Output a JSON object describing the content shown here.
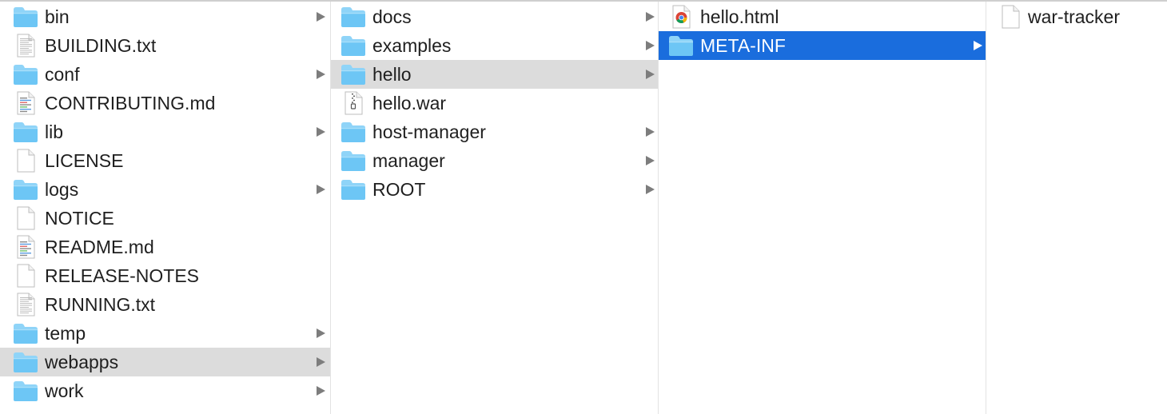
{
  "columns": [
    {
      "items": [
        {
          "label": "bin",
          "icon": "folder-icon",
          "arrow": true
        },
        {
          "label": "BUILDING.txt",
          "icon": "text-file-icon",
          "arrow": false
        },
        {
          "label": "conf",
          "icon": "folder-icon",
          "arrow": true
        },
        {
          "label": "CONTRIBUTING.md",
          "icon": "markdown-file-icon",
          "arrow": false
        },
        {
          "label": "lib",
          "icon": "folder-icon",
          "arrow": true
        },
        {
          "label": "LICENSE",
          "icon": "blank-file-icon",
          "arrow": false
        },
        {
          "label": "logs",
          "icon": "folder-icon",
          "arrow": true
        },
        {
          "label": "NOTICE",
          "icon": "blank-file-icon",
          "arrow": false
        },
        {
          "label": "README.md",
          "icon": "markdown-file-icon",
          "arrow": false
        },
        {
          "label": "RELEASE-NOTES",
          "icon": "blank-file-icon",
          "arrow": false
        },
        {
          "label": "RUNNING.txt",
          "icon": "text-file-icon",
          "arrow": false
        },
        {
          "label": "temp",
          "icon": "folder-icon",
          "arrow": true
        },
        {
          "label": "webapps",
          "icon": "folder-icon",
          "arrow": true,
          "selected": "gray"
        },
        {
          "label": "work",
          "icon": "folder-icon",
          "arrow": true
        }
      ]
    },
    {
      "items": [
        {
          "label": "docs",
          "icon": "folder-icon",
          "arrow": true
        },
        {
          "label": "examples",
          "icon": "folder-icon",
          "arrow": true
        },
        {
          "label": "hello",
          "icon": "folder-icon",
          "arrow": true,
          "selected": "gray"
        },
        {
          "label": "hello.war",
          "icon": "archive-file-icon",
          "arrow": false
        },
        {
          "label": "host-manager",
          "icon": "folder-icon",
          "arrow": true
        },
        {
          "label": "manager",
          "icon": "folder-icon",
          "arrow": true
        },
        {
          "label": "ROOT",
          "icon": "folder-icon",
          "arrow": true
        }
      ]
    },
    {
      "items": [
        {
          "label": "hello.html",
          "icon": "chrome-html-file-icon",
          "arrow": false
        },
        {
          "label": "META-INF",
          "icon": "folder-icon",
          "arrow": true,
          "selected": "blue"
        }
      ]
    },
    {
      "items": [
        {
          "label": "war-tracker",
          "icon": "blank-file-icon",
          "arrow": false
        }
      ]
    }
  ],
  "colors": {
    "selection_blue": "#1a6ddd",
    "selection_gray": "#dcdcdc",
    "folder": "#6dc6f5",
    "folder_tab": "#8fd4f8"
  }
}
